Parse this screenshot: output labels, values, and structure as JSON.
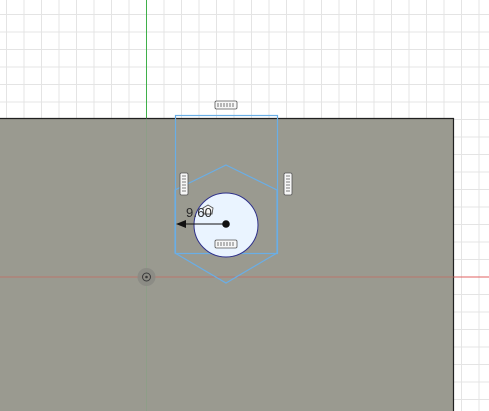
{
  "viewport": {
    "background_color": "#ffffff",
    "grid_color": "#e4e4e4",
    "axis_x_color": "#e06060",
    "axis_y_color": "#3fb04a",
    "body_color": "#9a9a90",
    "body_edge_color": "#202020",
    "sketch_color": "#6aaee6",
    "hole_fill": "#eaf4ff",
    "hole_outline": "#2d2f8a"
  },
  "sketch": {
    "dimension_value": "9.60",
    "constraint_icons": [
      "horizontal-constraint-icon",
      "vertical-constraint-icon",
      "vertical-constraint-icon",
      "horizontal-constraint-icon",
      "polygon-constraint-icon"
    ]
  },
  "origin": {
    "icon": "origin-point-icon"
  }
}
